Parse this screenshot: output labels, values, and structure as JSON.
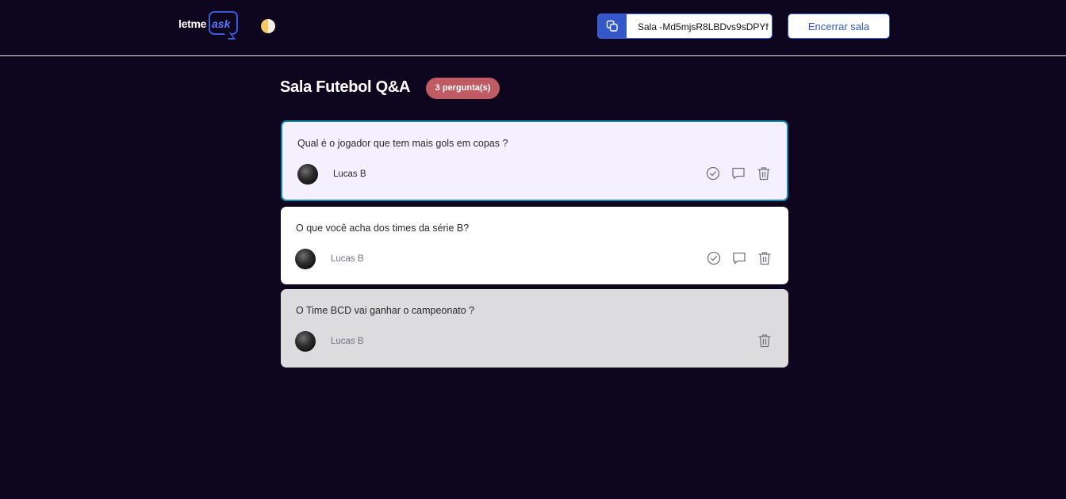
{
  "header": {
    "logo_text": "letme",
    "logo_accent": "ask",
    "room_code": "Sala -Md5mjsR8LBDvs9sDPYf",
    "close_room_label": "Encerrar sala"
  },
  "room": {
    "title": "Sala Futebol Q&A",
    "question_count": "3 pergunta(s)"
  },
  "questions": [
    {
      "text": "Qual é o jogador que tem mais gols em copas ?",
      "author": "Lucas B",
      "state": "highlighted"
    },
    {
      "text": "O que você acha dos times da série B?",
      "author": "Lucas B",
      "state": "normal"
    },
    {
      "text": "O Time BCD vai ganhar o campeonato ?",
      "author": "Lucas B",
      "state": "answered"
    }
  ],
  "icons": {
    "copy": "copy-icon",
    "check": "check-circle-icon",
    "answer": "chat-bubble-icon",
    "delete": "trash-icon",
    "theme": "theme-toggle-icon"
  },
  "colors": {
    "background": "#0e051e",
    "brand": "#3458c7",
    "badge": "#c05b63",
    "highlight_border": "#1789a6"
  }
}
